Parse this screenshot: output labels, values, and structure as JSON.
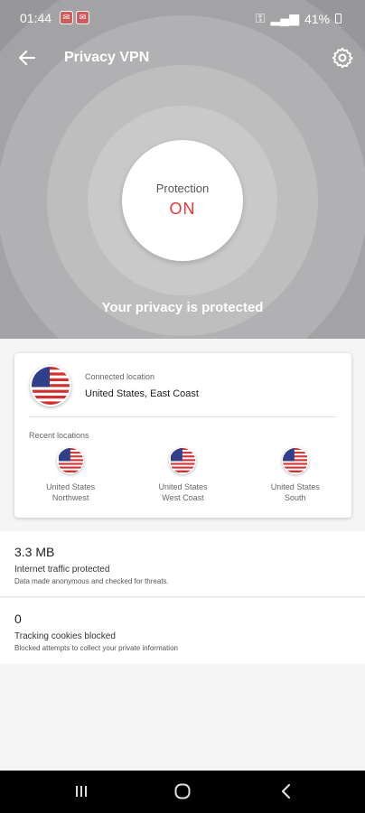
{
  "status_bar": {
    "time": "01:44",
    "battery": "41%"
  },
  "header": {
    "title": "Privacy VPN"
  },
  "protection": {
    "label": "Protection",
    "state": "ON",
    "message": "Your privacy is protected"
  },
  "connected": {
    "caption": "Connected location",
    "location": "United States, East Coast"
  },
  "recent": {
    "caption": "Recent locations",
    "items": [
      {
        "line1": "United States",
        "line2": "Northwest"
      },
      {
        "line1": "United States",
        "line2": "West Coast"
      },
      {
        "line1": "United States",
        "line2": "South"
      }
    ]
  },
  "stats": [
    {
      "value": "3.3 MB",
      "title": "Internet traffic protected",
      "description": "Data made anonymous and checked for threats."
    },
    {
      "value": "0",
      "title": "Tracking cookies blocked",
      "description": "Blocked attempts to collect your private information"
    }
  ],
  "colors": {
    "accent_red": "#e53935",
    "hero_gray": "#8e8e90"
  },
  "icons": [
    "back-arrow-icon",
    "gear-icon",
    "us-flag-icon",
    "recents-icon",
    "home-icon",
    "nav-back-icon"
  ]
}
